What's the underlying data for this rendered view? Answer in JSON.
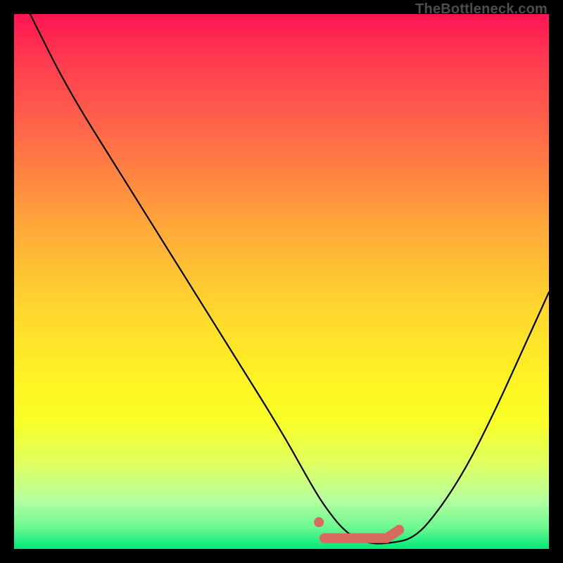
{
  "attribution": "TheBottleneck.com",
  "colors": {
    "frame": "#000000",
    "gradient_top": "#ff1452",
    "gradient_bottom": "#00e878",
    "curve": "#000000",
    "marker": "#d86a60"
  },
  "chart_data": {
    "type": "line",
    "title": "",
    "xlabel": "",
    "ylabel": "",
    "xlim": [
      0,
      100
    ],
    "ylim": [
      0,
      100
    ],
    "x": [
      3,
      10,
      20,
      30,
      40,
      50,
      55,
      58,
      62,
      66,
      70,
      75,
      80,
      85,
      90,
      95,
      100
    ],
    "y": [
      100,
      86,
      70,
      54,
      38,
      22,
      13,
      8,
      3,
      1,
      1,
      2,
      8,
      16,
      26,
      37,
      48
    ],
    "annotations": {
      "optimal_range_x": [
        58,
        72
      ],
      "optimal_range_y": 2,
      "optimal_dot": {
        "x": 57,
        "y": 5
      }
    }
  }
}
